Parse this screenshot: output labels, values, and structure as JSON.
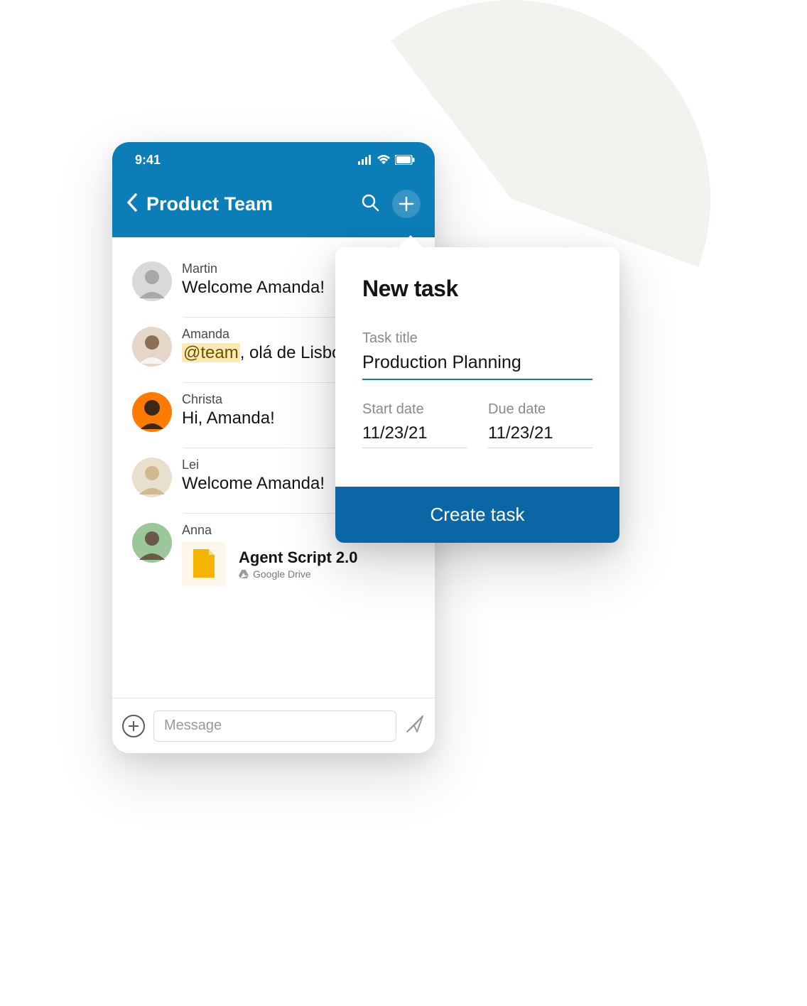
{
  "status": {
    "time": "9:41"
  },
  "header": {
    "title": "Product Team"
  },
  "messages": [
    {
      "author": "Martin",
      "text": "Welcome Amanda!"
    },
    {
      "author": "Amanda",
      "mention": "@team",
      "rest": ", olá de Lisboa!"
    },
    {
      "author": "Christa",
      "text": "Hi, Amanda!"
    },
    {
      "author": "Lei",
      "text": "Welcome Amanda!"
    },
    {
      "author": "Anna",
      "attachment": {
        "title": "Agent Script 2.0",
        "source": "Google Drive"
      }
    }
  ],
  "composer": {
    "placeholder": "Message"
  },
  "popover": {
    "title": "New task",
    "task_title_label": "Task title",
    "task_title_value": "Production Planning",
    "start_label": "Start date",
    "start_value": "11/23/21",
    "due_label": "Due date",
    "due_value": "11/23/21",
    "button": "Create task"
  },
  "avatar_colors": [
    "#d9d9d9",
    "#e4d7c9",
    "#ff7a00",
    "#e8dfcf",
    "#9bc79b"
  ]
}
